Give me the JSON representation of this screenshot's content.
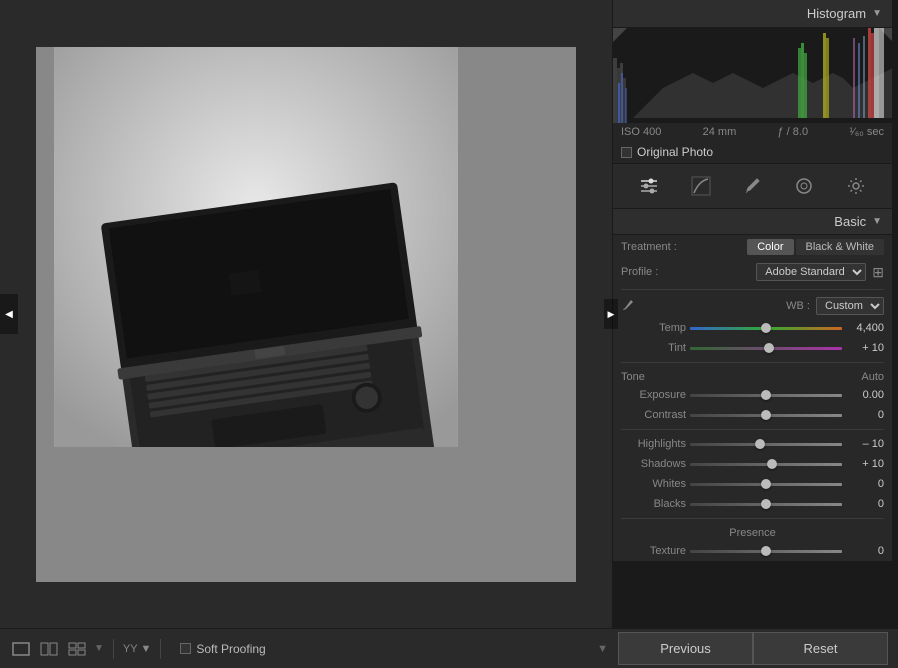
{
  "header": {
    "histogram_title": "Histogram",
    "histogram_arrow": "▼"
  },
  "histogram": {
    "meta": {
      "iso": "ISO 400",
      "focal_length": "24 mm",
      "aperture": "ƒ / 8.0",
      "shutter": "¹⁄₆₀ sec"
    },
    "original_photo_label": "Original Photo"
  },
  "tools": {
    "icons": [
      {
        "name": "sliders-icon",
        "symbol": "⊞",
        "active": true
      },
      {
        "name": "curves-icon",
        "symbol": "⤵",
        "active": false
      },
      {
        "name": "brush-icon",
        "symbol": "●",
        "active": false
      },
      {
        "name": "radial-icon",
        "symbol": "◎",
        "active": false
      },
      {
        "name": "settings-icon",
        "symbol": "⚙",
        "active": false
      }
    ]
  },
  "basic_panel": {
    "title": "Basic",
    "arrow": "▼",
    "treatment_label": "Treatment :",
    "treatment_color": "Color",
    "treatment_bw": "Black & White",
    "profile_label": "Profile :",
    "profile_value": "Adobe Standard",
    "wb_label": "WB :",
    "wb_value": "Custom",
    "sliders": [
      {
        "label": "Temp",
        "value": "4,400",
        "percent": 50
      },
      {
        "label": "Tint",
        "value": "+ 10",
        "percent": 52
      }
    ],
    "tone_label": "Tone",
    "auto_label": "Auto",
    "tone_sliders": [
      {
        "label": "Exposure",
        "value": "0.00",
        "percent": 50
      },
      {
        "label": "Contrast",
        "value": "0",
        "percent": 50
      },
      {
        "label": "Highlights",
        "value": "– 10",
        "percent": 46
      },
      {
        "label": "Shadows",
        "value": "+ 10",
        "percent": 54
      },
      {
        "label": "Whites",
        "value": "0",
        "percent": 50
      },
      {
        "label": "Blacks",
        "value": "0",
        "percent": 50
      }
    ],
    "presence_label": "Presence",
    "texture_label": "Texture",
    "texture_value": "0"
  },
  "toolbar": {
    "soft_proofing_label": "Soft Proofing",
    "previous_label": "Previous",
    "reset_label": "Reset"
  },
  "toolbar_icons": [
    {
      "name": "view-icon",
      "symbol": "▭"
    },
    {
      "name": "grid-2-icon",
      "symbol": "⊟"
    },
    {
      "name": "grid-3-icon",
      "symbol": "⊞"
    },
    {
      "name": "dropdown-icon",
      "symbol": "▼"
    }
  ]
}
